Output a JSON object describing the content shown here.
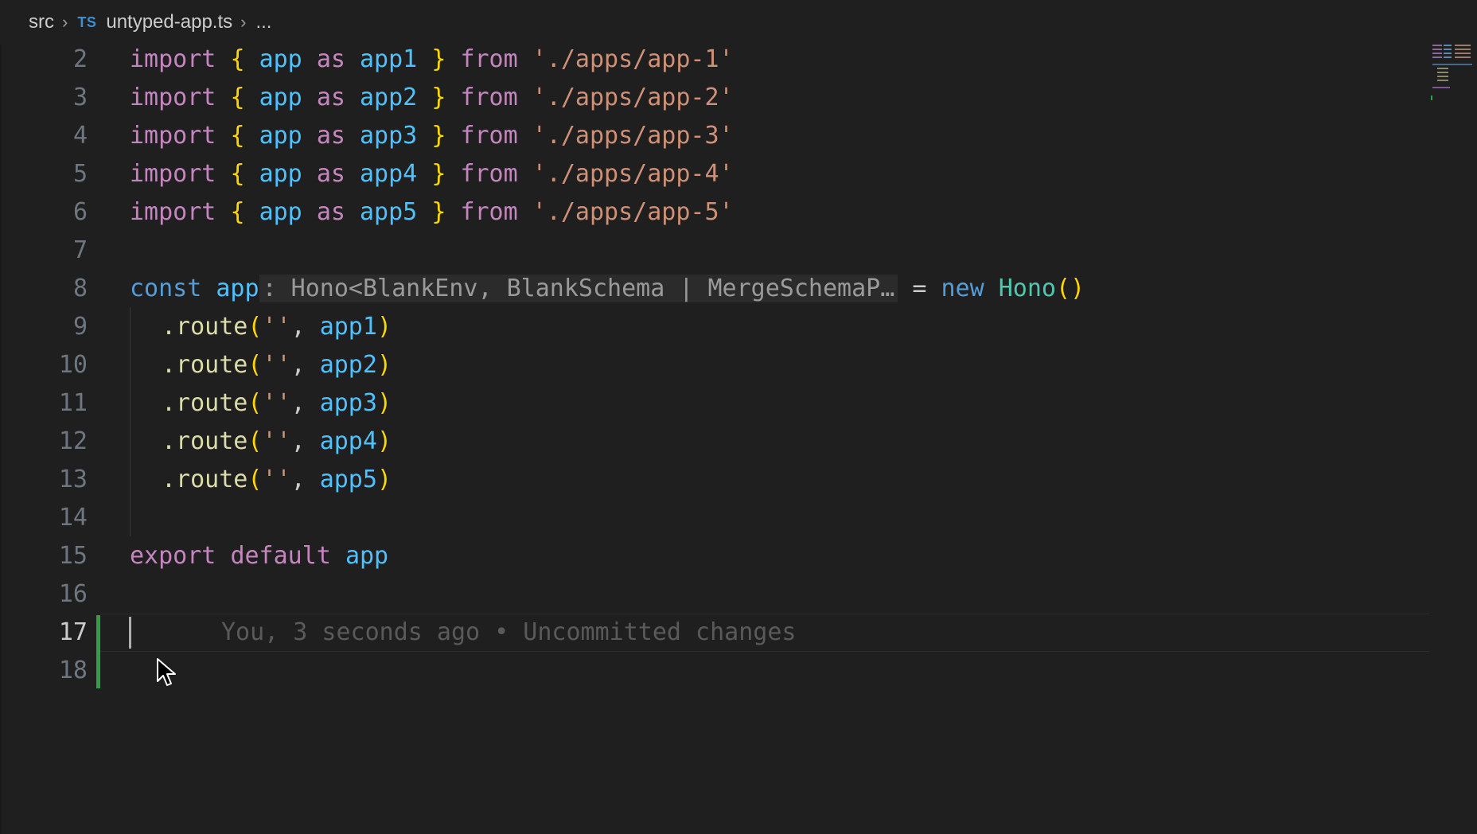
{
  "breadcrumb": {
    "folder": "src",
    "file_badge": "TS",
    "file": "untyped-app.ts",
    "more": "..."
  },
  "colors": {
    "background": "#1f1f1f",
    "keyword_import": "#c586c0",
    "keyword_blue": "#569cd6",
    "variable": "#4fc1ff",
    "brace": "#ffd700",
    "string": "#ce9178",
    "function": "#dcdcaa",
    "class": "#4ec9b0",
    "git_added": "#2ea043"
  },
  "code": {
    "lines": [
      {
        "n": "2",
        "import": "import",
        "open": "{",
        "name": "app",
        "as": "as",
        "alias": "app1",
        "close": "}",
        "from": "from",
        "path": "'./apps/app-1'"
      },
      {
        "n": "3",
        "import": "import",
        "open": "{",
        "name": "app",
        "as": "as",
        "alias": "app2",
        "close": "}",
        "from": "from",
        "path": "'./apps/app-2'"
      },
      {
        "n": "4",
        "import": "import",
        "open": "{",
        "name": "app",
        "as": "as",
        "alias": "app3",
        "close": "}",
        "from": "from",
        "path": "'./apps/app-3'"
      },
      {
        "n": "5",
        "import": "import",
        "open": "{",
        "name": "app",
        "as": "as",
        "alias": "app4",
        "close": "}",
        "from": "from",
        "path": "'./apps/app-4'"
      },
      {
        "n": "6",
        "import": "import",
        "open": "{",
        "name": "app",
        "as": "as",
        "alias": "app5",
        "close": "}",
        "from": "from",
        "path": "'./apps/app-5'"
      }
    ],
    "line7": "7",
    "line8": {
      "n": "8",
      "const": "const",
      "name": "app",
      "inlay_hint": ": Hono<BlankEnv, BlankSchema | MergeSchemaP…",
      "eq": "=",
      "new": "new",
      "cls": "Hono",
      "parens": "()"
    },
    "routes": [
      {
        "n": "9",
        "method": ".route",
        "open": "(",
        "str": "''",
        "comma": ",",
        "arg": "app1",
        "close": ")"
      },
      {
        "n": "10",
        "method": ".route",
        "open": "(",
        "str": "''",
        "comma": ",",
        "arg": "app2",
        "close": ")"
      },
      {
        "n": "11",
        "method": ".route",
        "open": "(",
        "str": "''",
        "comma": ",",
        "arg": "app3",
        "close": ")"
      },
      {
        "n": "12",
        "method": ".route",
        "open": "(",
        "str": "''",
        "comma": ",",
        "arg": "app4",
        "close": ")"
      },
      {
        "n": "13",
        "method": ".route",
        "open": "(",
        "str": "''",
        "comma": ",",
        "arg": "app5",
        "close": ")"
      }
    ],
    "line14": "14",
    "line15": {
      "n": "15",
      "export": "export",
      "default": "default",
      "name": "app"
    },
    "line16": "16",
    "line17": "17",
    "line18": "18",
    "blame": "You, 3 seconds ago • Uncommitted changes"
  }
}
